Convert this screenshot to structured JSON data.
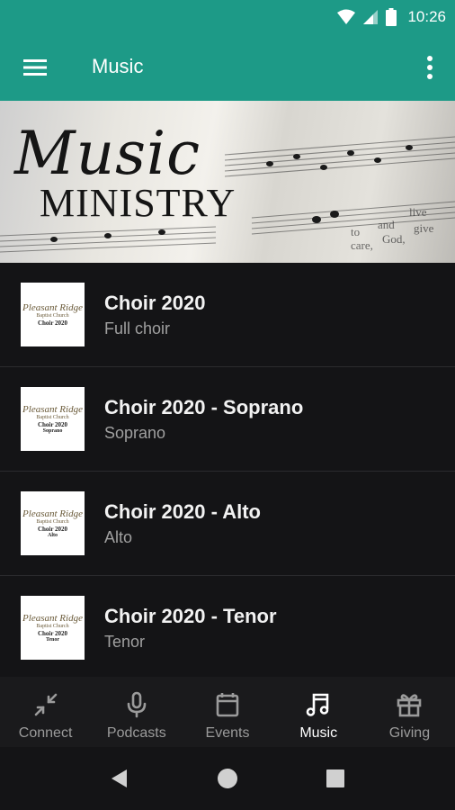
{
  "status": {
    "time": "10:26"
  },
  "appbar": {
    "title": "Music",
    "menu_icon": "hamburger-menu-icon",
    "more_icon": "more-vert-icon"
  },
  "banner": {
    "script_text": "Music",
    "caps_text": "Ministry"
  },
  "list": [
    {
      "title": "Choir 2020",
      "subtitle": "Full choir",
      "thumb": {
        "script": "Pleasant Ridge",
        "line2": "Baptist Church",
        "line3": "Choir 2020",
        "line4": ""
      }
    },
    {
      "title": "Choir 2020 - Soprano",
      "subtitle": "Soprano",
      "thumb": {
        "script": "Pleasant Ridge",
        "line2": "Baptist Church",
        "line3": "Choir 2020",
        "line4": "Soprano"
      }
    },
    {
      "title": "Choir 2020 - Alto",
      "subtitle": "Alto",
      "thumb": {
        "script": "Pleasant Ridge",
        "line2": "Baptist Church",
        "line3": "Choir 2020",
        "line4": "Alto"
      }
    },
    {
      "title": "Choir 2020 - Tenor",
      "subtitle": "Tenor",
      "thumb": {
        "script": "Pleasant Ridge",
        "line2": "Baptist Church",
        "line3": "Choir 2020",
        "line4": "Tenor"
      }
    }
  ],
  "bottom_nav": [
    {
      "label": "Connect",
      "icon": "connect-icon",
      "active": false
    },
    {
      "label": "Podcasts",
      "icon": "microphone-icon",
      "active": false
    },
    {
      "label": "Events",
      "icon": "calendar-icon",
      "active": false
    },
    {
      "label": "Music",
      "icon": "music-note-icon",
      "active": true
    },
    {
      "label": "Giving",
      "icon": "gift-icon",
      "active": false
    }
  ],
  "colors": {
    "accent": "#1d9a87",
    "background": "#141416",
    "nav_inactive": "#9b9b9b"
  }
}
